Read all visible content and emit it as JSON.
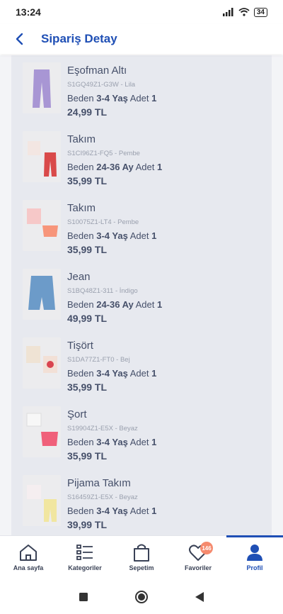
{
  "status": {
    "time": "13:24",
    "battery": "34"
  },
  "header": {
    "title": "Sipariş Detay"
  },
  "size_label": "Beden",
  "qty_label": "Adet",
  "products": [
    {
      "name": "Eşofman Altı",
      "code": "S1GQ49Z1-G3W - Lila",
      "size": "3-4 Yaş",
      "qty": "1",
      "price": "24,99 TL"
    },
    {
      "name": "Takım",
      "code": "S1CI96Z1-FQ5 - Pembe",
      "size": "24-36 Ay",
      "qty": "1",
      "price": "35,99 TL"
    },
    {
      "name": "Takım",
      "code": "S10075Z1-LT4 - Pembe",
      "size": "3-4 Yaş",
      "qty": "1",
      "price": "35,99 TL"
    },
    {
      "name": "Jean",
      "code": "S1BQ48Z1-311 - İndigo",
      "size": "24-36 Ay",
      "qty": "1",
      "price": "49,99 TL"
    },
    {
      "name": "Tişört",
      "code": "S1DA77Z1-FT0 - Bej",
      "size": "3-4 Yaş",
      "qty": "1",
      "price": "35,99 TL"
    },
    {
      "name": "Şort",
      "code": "S19904Z1-E5X - Beyaz",
      "size": "3-4 Yaş",
      "qty": "1",
      "price": "35,99 TL"
    },
    {
      "name": "Pijama Takım",
      "code": "S16459Z1-E5X - Beyaz",
      "size": "3-4 Yaş",
      "qty": "1",
      "price": "39,99 TL"
    }
  ],
  "tabs": [
    {
      "label": "Ana sayfa"
    },
    {
      "label": "Kategoriler"
    },
    {
      "label": "Sepetim"
    },
    {
      "label": "Favoriler",
      "badge": "146"
    },
    {
      "label": "Profil"
    }
  ],
  "colors": {
    "accent": "#1f4fb5",
    "badge": "#f58a6e",
    "text": "#46506a",
    "card": "#e7e9ef"
  }
}
